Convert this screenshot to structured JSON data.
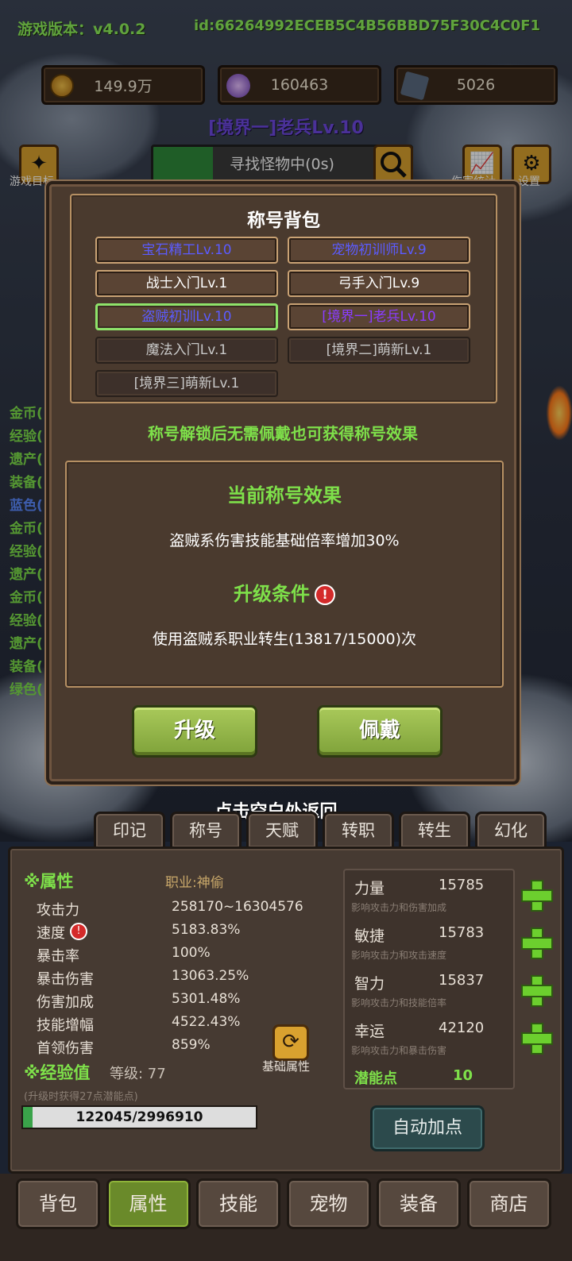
{
  "header": {
    "version": "游戏版本：v4.0.2",
    "player_id": "id:66264992ECEB5C4B56BBD75F30C4C0F1"
  },
  "resources": [
    {
      "icon": "gold-coin-icon",
      "value": "149.9万"
    },
    {
      "icon": "crystal-flower-icon",
      "value": "160463"
    },
    {
      "icon": "card-icon",
      "value": "5026"
    }
  ],
  "realm_title": "[境界一]老兵Lv.10",
  "search": {
    "label": "寻找怪物中(0s)",
    "progress": 0.23
  },
  "top_buttons": {
    "goal_label": "游戏目标",
    "stats_label": "伤害统计",
    "settings_label": "设置"
  },
  "side_stats": [
    "金币(",
    "经验(",
    "遗产(",
    "装备(",
    "蓝色(",
    "金币(",
    "经验(",
    "遗产(",
    "金币(",
    "经验(",
    "遗产(",
    "装备(",
    "绿色("
  ],
  "modal": {
    "title": "称号背包",
    "titles": [
      {
        "label": "宝石精工Lv.10",
        "color": "#5b5bff",
        "locked": false,
        "selected": false
      },
      {
        "label": "宠物初训师Lv.9",
        "color": "#5b5bff",
        "locked": false,
        "selected": false
      },
      {
        "label": "战士入门Lv.1",
        "color": "#ffffff",
        "locked": false,
        "selected": false
      },
      {
        "label": "弓手入门Lv.9",
        "color": "#ffffff",
        "locked": false,
        "selected": false
      },
      {
        "label": "盗贼初训Lv.10",
        "color": "#5b5bff",
        "locked": false,
        "selected": true
      },
      {
        "label": "[境界一]老兵Lv.10",
        "color": "#8a3cff",
        "locked": false,
        "selected": false
      },
      {
        "label": "魔法入门Lv.1",
        "color": "#c8c8c8",
        "locked": true,
        "selected": false
      },
      {
        "label": "[境界二]萌新Lv.1",
        "color": "#c8c8c8",
        "locked": true,
        "selected": false
      },
      {
        "label": "[境界三]萌新Lv.1",
        "color": "#c8c8c8",
        "locked": true,
        "selected": false
      }
    ],
    "note": "称号解锁后无需佩戴也可获得称号效果",
    "effect_title": "当前称号效果",
    "effect_text": "盗贼系伤害技能基础倍率增加30%",
    "upgrade_title": "升级条件",
    "upgrade_text": "使用盗贼系职业转生(13817/15000)次",
    "upgrade_button": "升级",
    "wear_button": "佩戴"
  },
  "tap_back": "点击空白处返回...",
  "tabs": [
    "印记",
    "称号",
    "天赋",
    "转职",
    "转生",
    "幻化"
  ],
  "attributes": {
    "section_title": "※属性",
    "job": "职业:神偷",
    "rows": [
      {
        "label": "攻击力",
        "value": "258170~16304576"
      },
      {
        "label": "速度",
        "value": "5183.83%"
      },
      {
        "label": "暴击率",
        "value": "100%"
      },
      {
        "label": "暴击伤害",
        "value": "13063.25%"
      },
      {
        "label": "伤害加成",
        "value": "5301.48%"
      },
      {
        "label": "技能增幅",
        "value": "4522.43%"
      },
      {
        "label": "首领伤害",
        "value": "859%"
      }
    ],
    "base_attr_label": "基础属性"
  },
  "base_stats": [
    {
      "name": "力量",
      "value": "15785",
      "desc": "影响攻击力和伤害加成"
    },
    {
      "name": "敏捷",
      "value": "15783",
      "desc": "影响攻击力和攻击速度"
    },
    {
      "name": "智力",
      "value": "15837",
      "desc": "影响攻击力和技能倍率"
    },
    {
      "name": "幸运",
      "value": "42120",
      "desc": "影响攻击力和暴击伤害"
    }
  ],
  "potential": {
    "label": "潜能点",
    "value": "10"
  },
  "experience": {
    "title": "※经验值",
    "level": "等级: 77",
    "hint": "(升级时获得27点潜能点)",
    "bar_text": "122045/2996910",
    "progress": 0.041
  },
  "auto_add": "自动加点",
  "nav": [
    {
      "label": "背包",
      "active": false
    },
    {
      "label": "属性",
      "active": true
    },
    {
      "label": "技能",
      "active": false
    },
    {
      "label": "宠物",
      "active": false
    },
    {
      "label": "装备",
      "active": false
    },
    {
      "label": "商店",
      "active": false
    }
  ],
  "colors": {
    "green_text": "#7ee04a",
    "gold_button": "#d9a12f",
    "modal_bg": "#4a3a2e"
  }
}
